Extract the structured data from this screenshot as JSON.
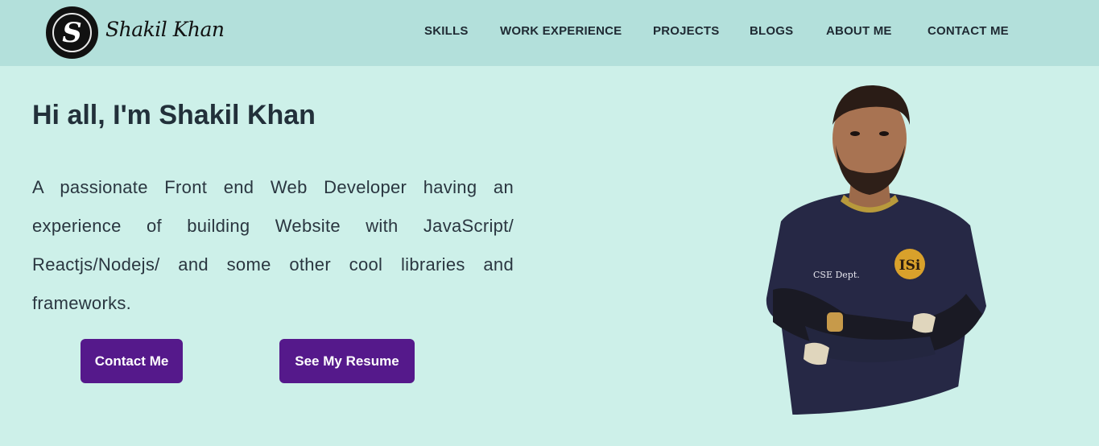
{
  "nav": {
    "logo_letter": "S",
    "logo_text": "Shakil Khan",
    "links": [
      "SKILLS",
      "WORK EXPERIENCE",
      "PROJECTS",
      "BLOGS",
      "ABOUT ME",
      "CONTACT ME"
    ]
  },
  "hero": {
    "title": "Hi all, I'm Shakil Khan",
    "description": "A passionate Front end Web Developer having an experience of building Website with JavaScript/ Reactjs/Nodejs/ and some other cool libraries and frameworks.",
    "buttons": {
      "contact": "Contact Me",
      "resume": "See My Resume"
    },
    "portrait": {
      "shirt_text": "CSE Dept.",
      "badge_text": "ISi"
    }
  },
  "colors": {
    "page_bg": "#cdf0e9",
    "navbar_bg": "#b3e0db",
    "button_bg": "#55198b",
    "text": "#22303a"
  }
}
